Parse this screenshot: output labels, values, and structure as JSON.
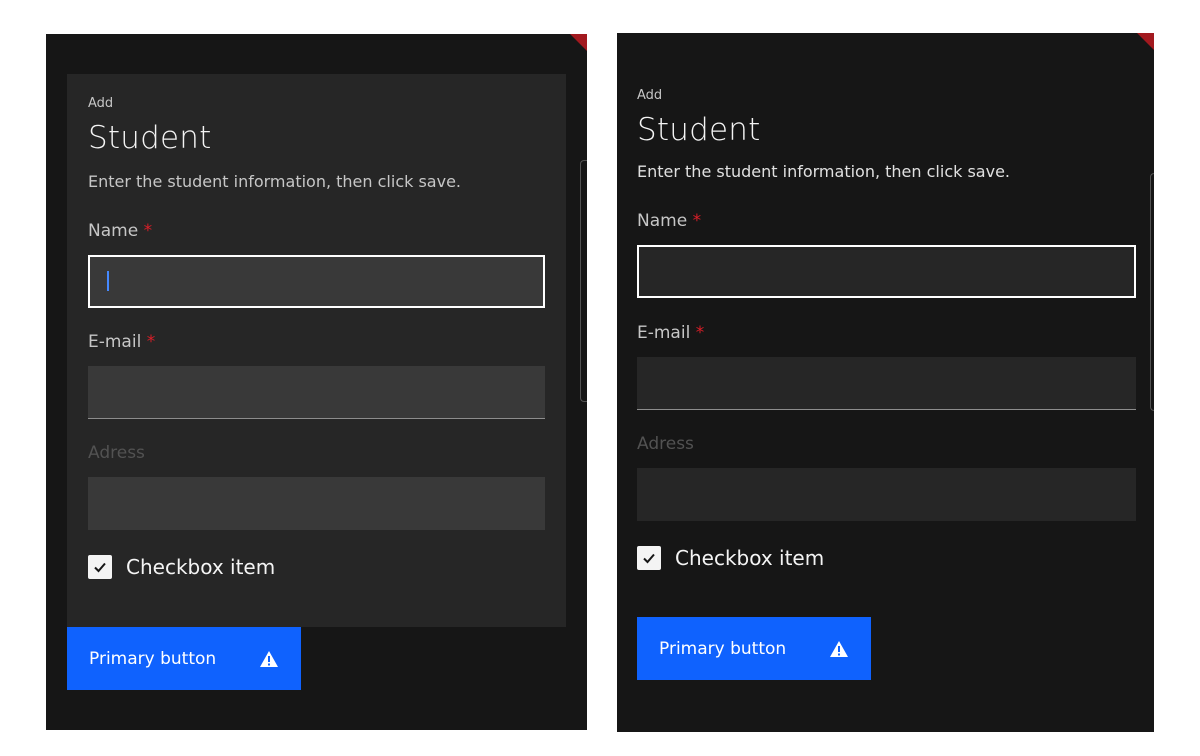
{
  "form": {
    "eyebrow": "Add",
    "title": "Student",
    "description": "Enter the student information, then click save.",
    "name_label": "Name",
    "email_label": "E-mail",
    "address_label": "Adress",
    "required_mark": "*",
    "name_value": "",
    "email_value": "",
    "address_value": "",
    "checkbox_label": "Checkbox item",
    "checkbox_checked": true,
    "primary_button_label": "Primary button",
    "button_icon": "warning-icon"
  },
  "colors": {
    "background": "#161616",
    "card": "#262626",
    "field": "#393939",
    "primary": "#0f62fe",
    "required": "#da1e28",
    "accent": "#a2191f"
  }
}
